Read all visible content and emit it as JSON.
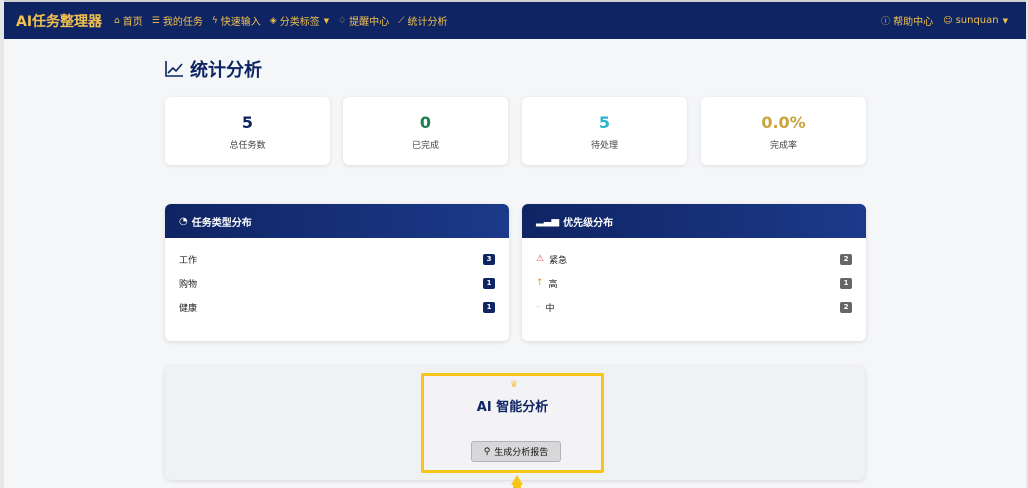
{
  "navbar": {
    "brand": "AI任务整理器",
    "items": [
      {
        "icon": "home-icon",
        "glyph": "⌂",
        "label": "首页"
      },
      {
        "icon": "list-icon",
        "glyph": "☰",
        "label": "我的任务"
      },
      {
        "icon": "bolt-icon",
        "glyph": "ϟ",
        "label": "快速输入"
      },
      {
        "icon": "tag-icon",
        "glyph": "⛉",
        "label": "分类标签"
      },
      {
        "icon": "bell-icon",
        "glyph": "♫",
        "label": "提醒中心"
      },
      {
        "icon": "chart-icon",
        "glyph": "⟋",
        "label": "统计分析"
      }
    ],
    "help_label": "帮助中心",
    "user_label": "sunquan"
  },
  "page": {
    "title": "统计分析"
  },
  "stats": [
    {
      "value": "5",
      "label": "总任务数",
      "color": "#0f2463"
    },
    {
      "value": "0",
      "label": "已完成",
      "color": "#1e7d4e"
    },
    {
      "value": "5",
      "label": "待处理",
      "color": "#2bb3d1"
    },
    {
      "value": "0.0%",
      "label": "完成率",
      "color": "#c9a33b"
    }
  ],
  "type_distribution": {
    "title": "任务类型分布",
    "rows": [
      {
        "label": "工作",
        "count": "3"
      },
      {
        "label": "购物",
        "count": "1"
      },
      {
        "label": "健康",
        "count": "1"
      }
    ]
  },
  "priority_distribution": {
    "title": "优先级分布",
    "rows": [
      {
        "label": "紧急",
        "count": "2",
        "icon": "warning-icon"
      },
      {
        "label": "高",
        "count": "1",
        "icon": "arrow-up-icon"
      },
      {
        "label": "中",
        "count": "2",
        "icon": "dash-icon"
      }
    ]
  },
  "ai": {
    "title": "AI 智能分析",
    "button_label": "生成分析报告"
  },
  "colors": {
    "navy": "#0f2463",
    "gold": "#f2c14e",
    "highlight": "#f5c518"
  }
}
